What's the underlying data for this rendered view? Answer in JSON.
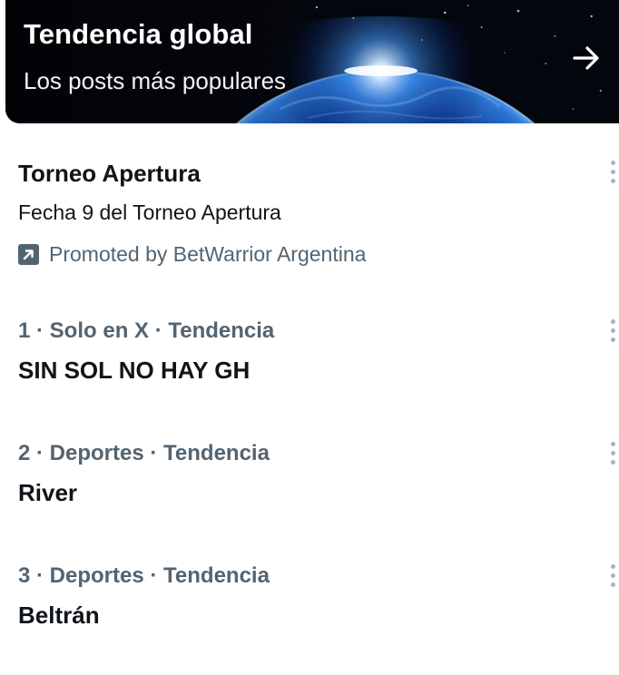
{
  "banner": {
    "title": "Tendencia global",
    "subtitle": "Los posts más populares",
    "arrow_icon": "arrow-right-icon"
  },
  "promoted_trend": {
    "title": "Torneo Apertura",
    "description": "Fecha 9 del Torneo Apertura",
    "promoted_label": "Promoted by BetWarrior Argentina",
    "icon": "promoted-icon"
  },
  "trends": [
    {
      "rank": "1",
      "context": "1 · Solo en X · Tendencia",
      "name": "SIN SOL NO HAY GH"
    },
    {
      "rank": "2",
      "context": "2 · Deportes · Tendencia",
      "name": "River"
    },
    {
      "rank": "3",
      "context": "3 · Deportes · Tendencia",
      "name": "Beltrán"
    }
  ],
  "colors": {
    "primary_text": "#0f1419",
    "secondary_text": "#536471",
    "banner_bg": "#05070f",
    "more_dots": "#aab4bd"
  }
}
